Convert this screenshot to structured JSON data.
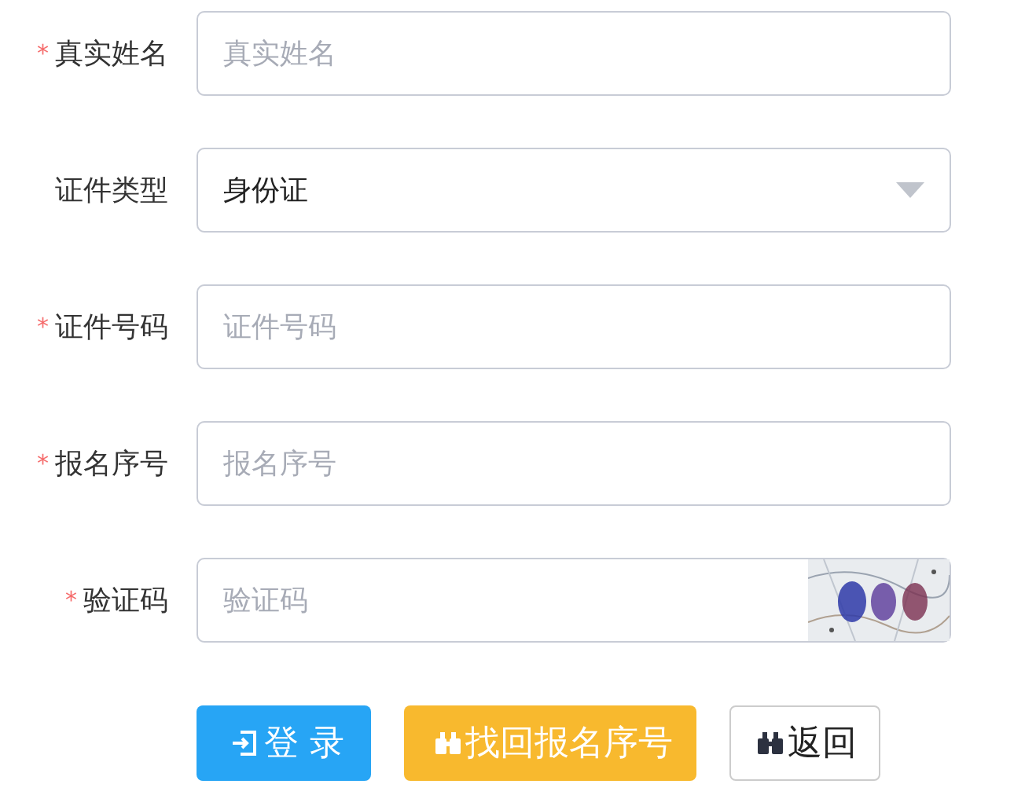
{
  "form": {
    "fields": [
      {
        "kind": "text",
        "marker": "*",
        "label": "真实姓名",
        "placeholder": "真实姓名"
      },
      {
        "kind": "select",
        "label": "证件类型",
        "value": "身份证"
      },
      {
        "kind": "text",
        "marker": "*",
        "label": "证件号码",
        "placeholder": "证件号码"
      },
      {
        "kind": "text",
        "marker": "*",
        "label": "报名序号",
        "placeholder": "报名序号"
      },
      {
        "kind": "captcha",
        "marker": "*",
        "label": "验证码",
        "placeholder": "验证码"
      }
    ],
    "buttons": [
      {
        "kind": "primary",
        "label": "登 录"
      },
      {
        "kind": "warning",
        "label": "找回报名序号"
      },
      {
        "kind": "default",
        "label": "返回"
      }
    ]
  }
}
